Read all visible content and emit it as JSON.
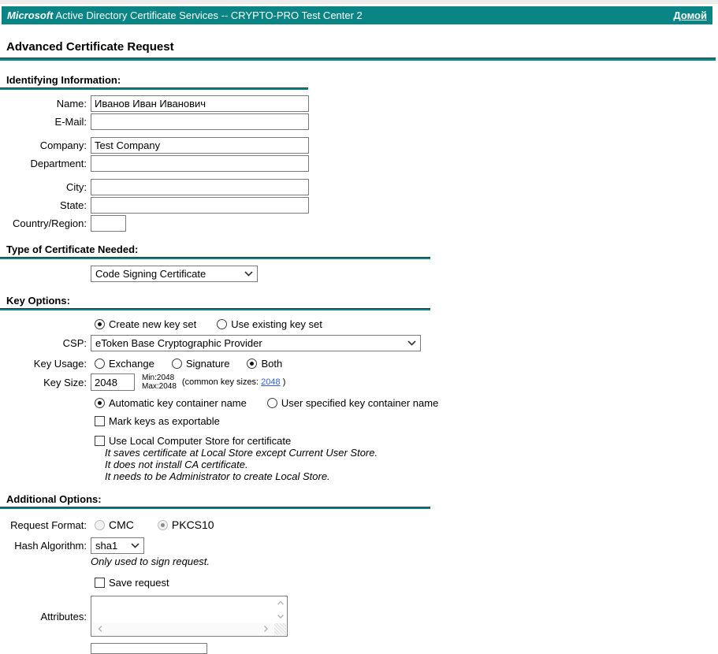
{
  "colors": {
    "banner": "#0a8585",
    "rule": "#0a8585",
    "link": "#2f5bd7"
  },
  "banner": {
    "brand": "Microsoft",
    "title": "Active Directory Certificate Services  --  CRYPTO-PRO Test Center 2",
    "home_link": "Домой"
  },
  "page": {
    "title": "Advanced Certificate Request"
  },
  "identifying": {
    "heading": "Identifying Information:",
    "fields": {
      "name": {
        "label": "Name:",
        "value": "Иванов Иван Иванович"
      },
      "email": {
        "label": "E-Mail:",
        "value": ""
      },
      "company": {
        "label": "Company:",
        "value": "Test Company"
      },
      "department": {
        "label": "Department:",
        "value": ""
      },
      "city": {
        "label": "City:",
        "value": ""
      },
      "state": {
        "label": "State:",
        "value": ""
      },
      "country": {
        "label": "Country/Region:",
        "value": ""
      }
    }
  },
  "cert_type": {
    "heading": "Type of Certificate Needed:",
    "selected": "Code Signing Certificate"
  },
  "key_options": {
    "heading": "Key Options:",
    "create_new_key_set": "Create new key set",
    "use_existing_key_set": "Use existing key set",
    "csp_label": "CSP:",
    "csp_value": "eToken Base Cryptographic Provider",
    "key_usage_label": "Key Usage:",
    "usage_exchange": "Exchange",
    "usage_signature": "Signature",
    "usage_both": "Both",
    "key_size_label": "Key Size:",
    "key_size_value": "2048",
    "min_text": "Min:2048",
    "max_text": "Max:2048",
    "common_prefix": "(common key sizes: ",
    "common_link": "2048",
    "common_suffix": " )",
    "auto_container": "Automatic key container name",
    "user_container": "User specified key container name",
    "exportable": "Mark keys as exportable",
    "local_store": "Use Local Computer Store for certificate",
    "local_store_notes": [
      "It saves certificate at Local Store except Current User Store.",
      "It does not install CA certificate.",
      "It needs to be Administrator to create Local Store."
    ]
  },
  "additional": {
    "heading": "Additional Options:",
    "request_format_label": "Request Format:",
    "format_cmc": "CMC",
    "format_pkcs10": "PKCS10",
    "hash_label": "Hash Algorithm:",
    "hash_value": "sha1",
    "hash_note": "Only used to sign request.",
    "save_request": "Save request",
    "attributes_label": "Attributes:"
  }
}
